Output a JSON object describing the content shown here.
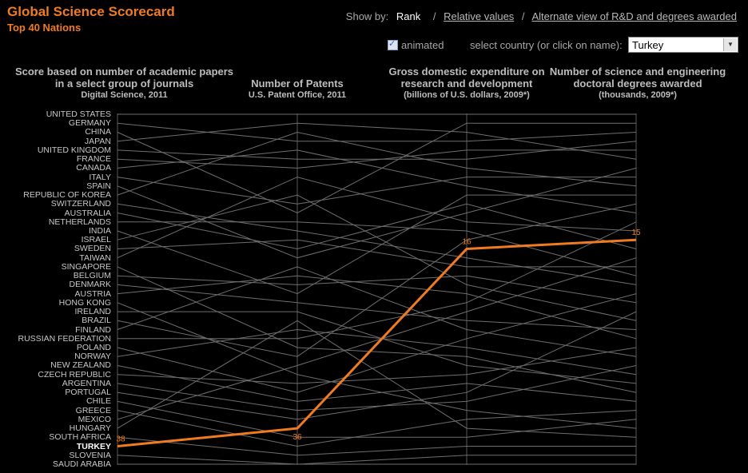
{
  "header": {
    "title": "Global Science Scorecard",
    "subtitle": "Top 40 Nations"
  },
  "controls": {
    "show_by_label": "Show by:",
    "options": [
      "Rank",
      "Relative values",
      "Alternate view of R&D and degrees awarded"
    ],
    "selected_option": "Rank",
    "separator": "/",
    "animated_label": "animated",
    "animated_checked": true,
    "select_label": "select country (or click on name):",
    "selected_country": "Turkey",
    "dropdown_arrow": "chevron-down-icon"
  },
  "chart_data": {
    "type": "line",
    "subtype": "parallel-coordinates-rank",
    "axes": [
      {
        "title": "Score based on number of academic papers in a select group of journals",
        "source": "Digital Science, 2011"
      },
      {
        "title": "Number of Patents",
        "source": "U.S. Patent Office, 2011"
      },
      {
        "title": "Gross domestic expenditure on research and development",
        "source": "(billions of U.S. dollars, 2009*)"
      },
      {
        "title": "Number of science and engineering doctoral degrees awarded",
        "source": "(thousands, 2009*)"
      }
    ],
    "rank_range": [
      1,
      40
    ],
    "countries": [
      "UNITED STATES",
      "GERMANY",
      "CHINA",
      "JAPAN",
      "UNITED KINGDOM",
      "FRANCE",
      "CANADA",
      "ITALY",
      "SPAIN",
      "REPUBLIC OF KOREA",
      "SWITZERLAND",
      "AUSTRALIA",
      "NETHERLANDS",
      "INDIA",
      "ISRAEL",
      "SWEDEN",
      "TAIWAN",
      "SINGAPORE",
      "BELGIUM",
      "DENMARK",
      "AUSTRIA",
      "HONG KONG",
      "IRELAND",
      "BRAZIL",
      "FINLAND",
      "RUSSIAN FEDERATION",
      "POLAND",
      "NORWAY",
      "NEW ZEALAND",
      "CZECH REPUBLIC",
      "ARGENTINA",
      "PORTUGAL",
      "CHILE",
      "GREECE",
      "MEXICO",
      "HUNGARY",
      "SOUTH AFRICA",
      "TURKEY",
      "SLOVENIA",
      "SAUDI ARABIA"
    ],
    "highlighted": {
      "country": "TURKEY",
      "ranks": [
        38,
        36,
        16,
        15
      ],
      "color": "#f07b20"
    },
    "series_ranks": [
      [
        1,
        1,
        1,
        1
      ],
      [
        2,
        4,
        4,
        3
      ],
      [
        3,
        12,
        2,
        2
      ],
      [
        4,
        2,
        3,
        6
      ],
      [
        5,
        6,
        6,
        4
      ],
      [
        6,
        7,
        5,
        5
      ],
      [
        7,
        5,
        9,
        12
      ],
      [
        8,
        11,
        8,
        8
      ],
      [
        9,
        17,
        12,
        7
      ],
      [
        10,
        3,
        7,
        9
      ],
      [
        11,
        14,
        17,
        20
      ],
      [
        12,
        16,
        11,
        16
      ],
      [
        13,
        13,
        14,
        19
      ],
      [
        14,
        21,
        10,
        10
      ],
      [
        15,
        10,
        20,
        24
      ],
      [
        16,
        15,
        18,
        18
      ],
      [
        17,
        8,
        13,
        14
      ],
      [
        18,
        27,
        28,
        32
      ],
      [
        19,
        20,
        19,
        22
      ],
      [
        20,
        22,
        24,
        25
      ],
      [
        21,
        19,
        21,
        26
      ],
      [
        22,
        30,
        34,
        36
      ],
      [
        23,
        23,
        29,
        31
      ],
      [
        24,
        28,
        15,
        11
      ],
      [
        25,
        18,
        25,
        28
      ],
      [
        26,
        26,
        22,
        13
      ],
      [
        27,
        32,
        26,
        21
      ],
      [
        28,
        25,
        27,
        30
      ],
      [
        29,
        33,
        31,
        33
      ],
      [
        30,
        31,
        30,
        27
      ],
      [
        31,
        34,
        33,
        29
      ],
      [
        32,
        35,
        32,
        23
      ],
      [
        33,
        37,
        37,
        35
      ],
      [
        34,
        38,
        35,
        34
      ],
      [
        35,
        29,
        23,
        17
      ],
      [
        36,
        24,
        36,
        37
      ],
      [
        37,
        39,
        38,
        38
      ],
      [
        38,
        36,
        16,
        15
      ],
      [
        39,
        40,
        39,
        39
      ],
      [
        40,
        40,
        40,
        40
      ]
    ],
    "data_labels": [
      "38",
      "36",
      "16",
      "15"
    ],
    "grid": false,
    "legend": "none"
  },
  "colors": {
    "background": "#000000",
    "accent": "#f07b20",
    "line": "#6e6e6e",
    "axis": "#5a5a5a"
  }
}
